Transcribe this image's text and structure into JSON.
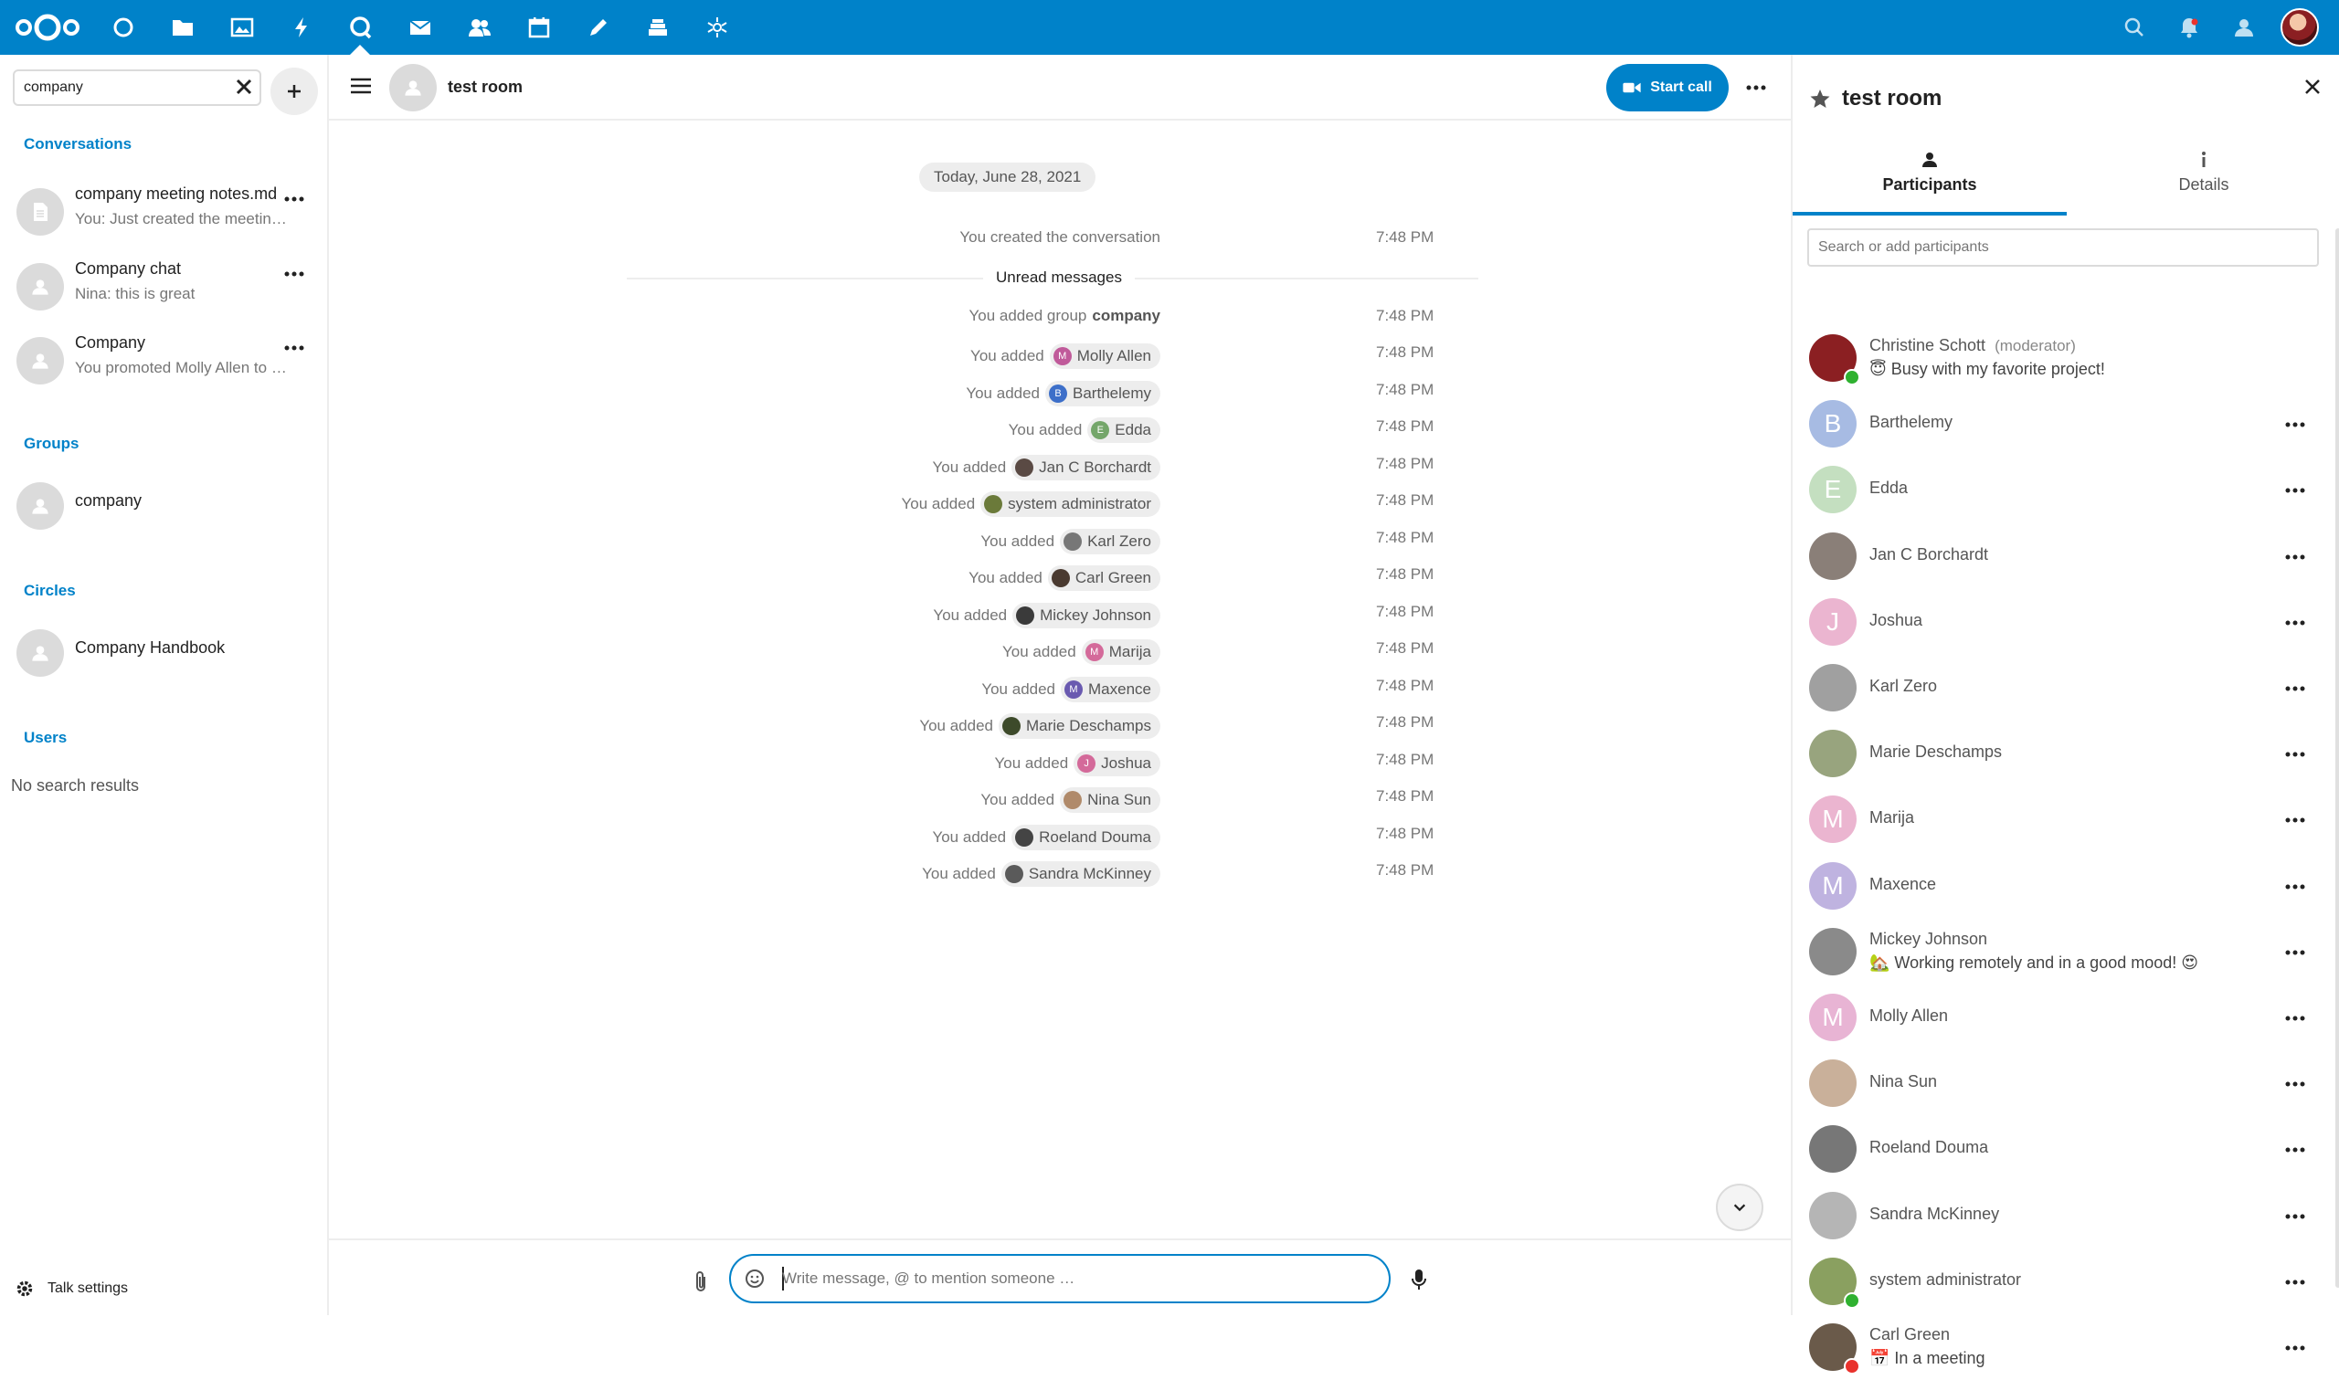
{
  "topbar": {
    "apps": [
      "dashboard",
      "files",
      "photos",
      "activity",
      "talk",
      "mail",
      "contacts",
      "calendar",
      "notes",
      "deck",
      "circles"
    ],
    "active_app": "talk",
    "right_icons": [
      "search",
      "notifications",
      "contacts-menu"
    ],
    "brand_color": "#0082c9"
  },
  "leftnav": {
    "search_value": "company",
    "sections": {
      "conversations": "Conversations",
      "groups": "Groups",
      "circles": "Circles",
      "users": "Users"
    },
    "conversations": [
      {
        "title": "company meeting notes.md",
        "subtitle": "You: Just created the meetin…",
        "icon": "file-icon"
      },
      {
        "title": "Company chat",
        "subtitle": "Nina: this is great",
        "icon": "group-icon"
      },
      {
        "title": "Company",
        "subtitle": "You promoted Molly Allen to …",
        "icon": "group-icon"
      }
    ],
    "groups": [
      {
        "title": "company"
      }
    ],
    "circles": [
      {
        "title": "Company Handbook"
      }
    ],
    "no_results": "No search results",
    "settings_label": "Talk settings"
  },
  "chat": {
    "room_title": "test room",
    "start_call_label": "Start call",
    "date_separator": "Today, June 28, 2021",
    "created_text": "You created the conversation",
    "created_time": "7:48 PM",
    "unread_label": "Unread messages",
    "group_prefix": "You added group",
    "group_name": "company",
    "added_prefix": "You added",
    "time": "7:48 PM",
    "added": [
      {
        "name": "Molly Allen",
        "initial": "M",
        "color": "#c05a9a"
      },
      {
        "name": "Barthelemy",
        "initial": "B",
        "color": "#3d6fc9"
      },
      {
        "name": "Edda",
        "initial": "E",
        "color": "#74a66a"
      },
      {
        "name": "Jan C Borchardt",
        "initial": "",
        "color": "#5a4a44"
      },
      {
        "name": "system administrator",
        "initial": "",
        "color": "#6b7a3a"
      },
      {
        "name": "Karl Zero",
        "initial": "",
        "color": "#777"
      },
      {
        "name": "Carl Green",
        "initial": "",
        "color": "#4a3a30"
      },
      {
        "name": "Mickey Johnson",
        "initial": "",
        "color": "#3a3a3a"
      },
      {
        "name": "Marija",
        "initial": "M",
        "color": "#d46a9a"
      },
      {
        "name": "Maxence",
        "initial": "M",
        "color": "#6a5ab0"
      },
      {
        "name": "Marie Deschamps",
        "initial": "",
        "color": "#3d4a2a"
      },
      {
        "name": "Joshua",
        "initial": "J",
        "color": "#d46a9a"
      },
      {
        "name": "Nina Sun",
        "initial": "",
        "color": "#b08a6a"
      },
      {
        "name": "Roeland Douma",
        "initial": "",
        "color": "#444"
      },
      {
        "name": "Sandra McKinney",
        "initial": "",
        "color": "#5a5a5a"
      }
    ],
    "composer_placeholder": "Write message, @ to mention someone …"
  },
  "sidebar": {
    "title": "test room",
    "tabs": [
      "Participants",
      "Details"
    ],
    "search_placeholder": "Search or add participants",
    "participants": [
      {
        "name": "Christine Schott",
        "role": "(moderator)",
        "status": "😇 Busy with my favorite project!",
        "initial": "",
        "color": "#8b1f22",
        "presence": "#2fb130"
      },
      {
        "name": "Barthelemy",
        "initial": "B",
        "color": "#a7bbe3"
      },
      {
        "name": "Edda",
        "initial": "E",
        "color": "#c4dfc0"
      },
      {
        "name": "Jan C Borchardt",
        "initial": "",
        "color": "#8a7f78"
      },
      {
        "name": "Joshua",
        "initial": "J",
        "color": "#ebb5d0"
      },
      {
        "name": "Karl Zero",
        "initial": "",
        "color": "#a0a0a0"
      },
      {
        "name": "Marie Deschamps",
        "initial": "",
        "color": "#98a47e"
      },
      {
        "name": "Marija",
        "initial": "M",
        "color": "#ebb5d0"
      },
      {
        "name": "Maxence",
        "initial": "M",
        "color": "#bfb3e0"
      },
      {
        "name": "Mickey Johnson",
        "status": "🏡 Working remotely and in a good mood! 😍",
        "initial": "",
        "color": "#8a8a8a"
      },
      {
        "name": "Molly Allen",
        "initial": "M",
        "color": "#e8b4d4"
      },
      {
        "name": "Nina Sun",
        "initial": "",
        "color": "#c9b09a"
      },
      {
        "name": "Roeland Douma",
        "initial": "",
        "color": "#777"
      },
      {
        "name": "Sandra McKinney",
        "initial": "",
        "color": "#b5b5b5"
      },
      {
        "name": "system administrator",
        "initial": "",
        "color": "#8aa060",
        "presence": "#2fb130"
      },
      {
        "name": "Carl Green",
        "status": "📅 In a meeting",
        "initial": "",
        "color": "#6a5a4a",
        "presence": "#e9322d"
      }
    ]
  }
}
